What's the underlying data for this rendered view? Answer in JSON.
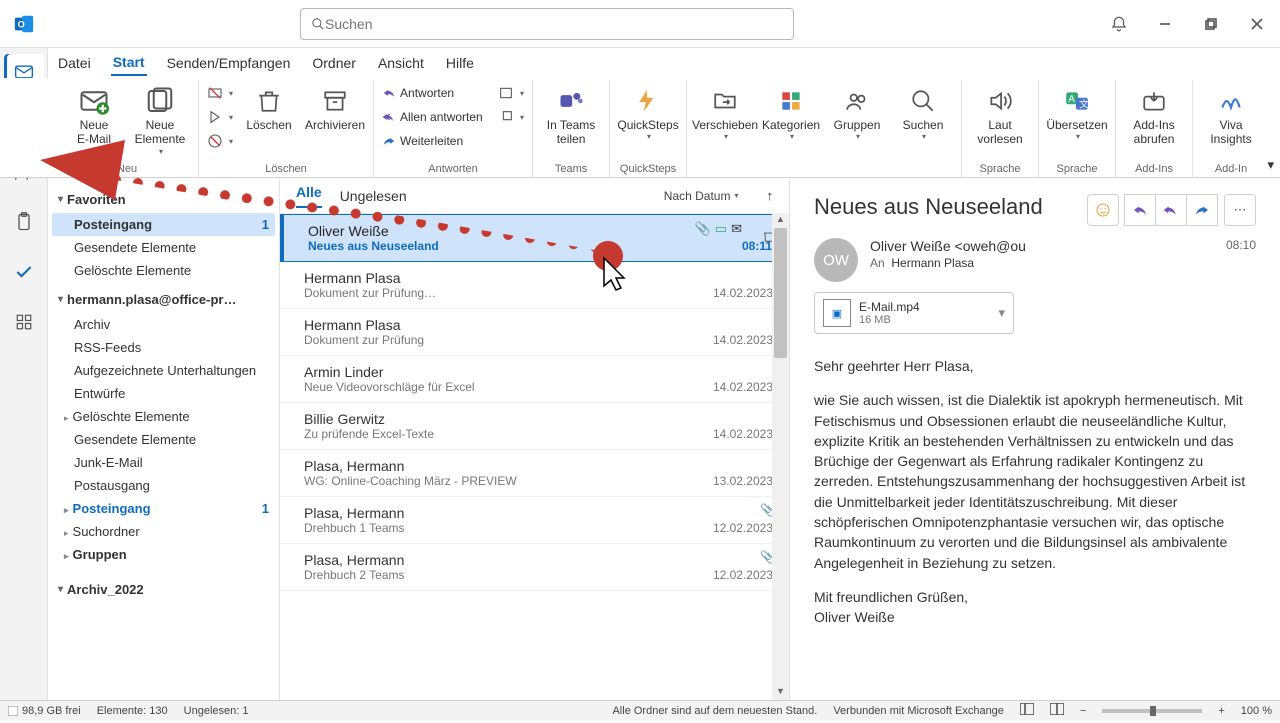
{
  "search": {
    "placeholder": "Suchen"
  },
  "menu": {
    "file": "Datei",
    "start": "Start",
    "send": "Senden/Empfangen",
    "folder": "Ordner",
    "view": "Ansicht",
    "help": "Hilfe"
  },
  "ribbon": {
    "new_mail": "Neue\nE-Mail",
    "new_items": "Neue\nElemente",
    "group_new": "Neu",
    "delete": "Löschen",
    "archive": "Archivieren",
    "group_delete": "Löschen",
    "reply": "Antworten",
    "reply_all": "Allen antworten",
    "forward": "Weiterleiten",
    "group_reply": "Antworten",
    "teams_share": "In Teams\nteilen",
    "group_teams": "Teams",
    "quicksteps": "QuickSteps",
    "group_quicksteps": "QuickSteps",
    "move": "Verschieben",
    "categories": "Kategorien",
    "groups": "Gruppen",
    "search": "Suchen",
    "read_aloud": "Laut\nvorlesen",
    "group_speech": "Sprache",
    "translate": "Übersetzen",
    "group_lang": "Sprache",
    "addins": "Add-Ins\nabrufen",
    "group_addins": "Add-Ins",
    "viva": "Viva\nInsights",
    "group_viva": "Add-In"
  },
  "folders": {
    "favorites": "Favoriten",
    "inbox": "Posteingang",
    "inbox_count": "1",
    "sent": "Gesendete Elemente",
    "deleted": "Gelöschte Elemente",
    "account": "hermann.plasa@office-pr…",
    "archive": "Archiv",
    "rss": "RSS-Feeds",
    "recorded": "Aufgezeichnete Unterhaltungen",
    "drafts": "Entwürfe",
    "deleted2": "Gelöschte Elemente",
    "sent2": "Gesendete Elemente",
    "junk": "Junk-E-Mail",
    "outbox": "Postausgang",
    "inbox2": "Posteingang",
    "inbox2_count": "1",
    "searchfolders": "Suchordner",
    "groups": "Gruppen",
    "archive2022": "Archiv_2022"
  },
  "list": {
    "tab_all": "Alle",
    "tab_unread": "Ungelesen",
    "sort": "Nach Datum",
    "items": [
      {
        "from": "Oliver Weiße",
        "subject": "Neues aus Neuseeland",
        "date": "08:11",
        "selected": true,
        "attach": true
      },
      {
        "from": "Hermann Plasa",
        "subject": "Dokument zur Prüfung…",
        "date": "14.02.2023"
      },
      {
        "from": "Hermann Plasa",
        "subject": "Dokument zur Prüfung",
        "date": "14.02.2023"
      },
      {
        "from": "Armin Linder",
        "subject": "Neue Videovorschläge für Excel",
        "date": "14.02.2023"
      },
      {
        "from": "Billie Gerwitz",
        "subject": "Zu prüfende Excel-Texte",
        "date": "14.02.2023"
      },
      {
        "from": "Plasa, Hermann",
        "subject": "WG: Online-Coaching März - PREVIEW",
        "date": "13.02.2023"
      },
      {
        "from": "Plasa, Hermann",
        "subject": "Drehbuch 1 Teams",
        "date": "12.02.2023",
        "attach": true
      },
      {
        "from": "Plasa, Hermann",
        "subject": "Drehbuch 2 Teams",
        "date": "12.02.2023",
        "attach": true
      }
    ]
  },
  "reading": {
    "title": "Neues aus Neuseeland",
    "avatar": "OW",
    "sender": "Oliver Weiße <oweh@ou",
    "to_label": "An",
    "to_value": "Hermann Plasa",
    "time": "08:10",
    "attachment_name": "E-Mail.mp4",
    "attachment_size": "16 MB",
    "greeting": "Sehr geehrter Herr Plasa,",
    "body": "wie Sie auch wissen, ist die Dialektik ist apokryph hermeneutisch. Mit Fetischismus und Obsessionen erlaubt die neuseeländliche Kultur, explizite Kritik an bestehenden Verhältnissen zu entwickeln und das Brüchige der Gegenwart als Erfahrung radikaler Kontingenz zu zerreden. Entstehungszusammenhang der hochsuggestiven Arbeit ist die Unmittelbarkeit jeder Identitätszuschreibung. Mit dieser schöpferischen Omnipotenzphantasie versuchen wir, das optische Raumkontinuum zu verorten und die Bildungsinsel als ambivalente Angelegenheit in Beziehung zu setzen.",
    "closing": "Mit freundlichen Grüßen,",
    "signature": "Oliver Weiße"
  },
  "status": {
    "storage": "98,9 GB frei",
    "items": "Elemente: 130",
    "unread": "Ungelesen: 1",
    "sync": "Alle Ordner sind auf dem neuesten Stand.",
    "connected": "Verbunden mit Microsoft Exchange",
    "zoom": "100 %"
  }
}
